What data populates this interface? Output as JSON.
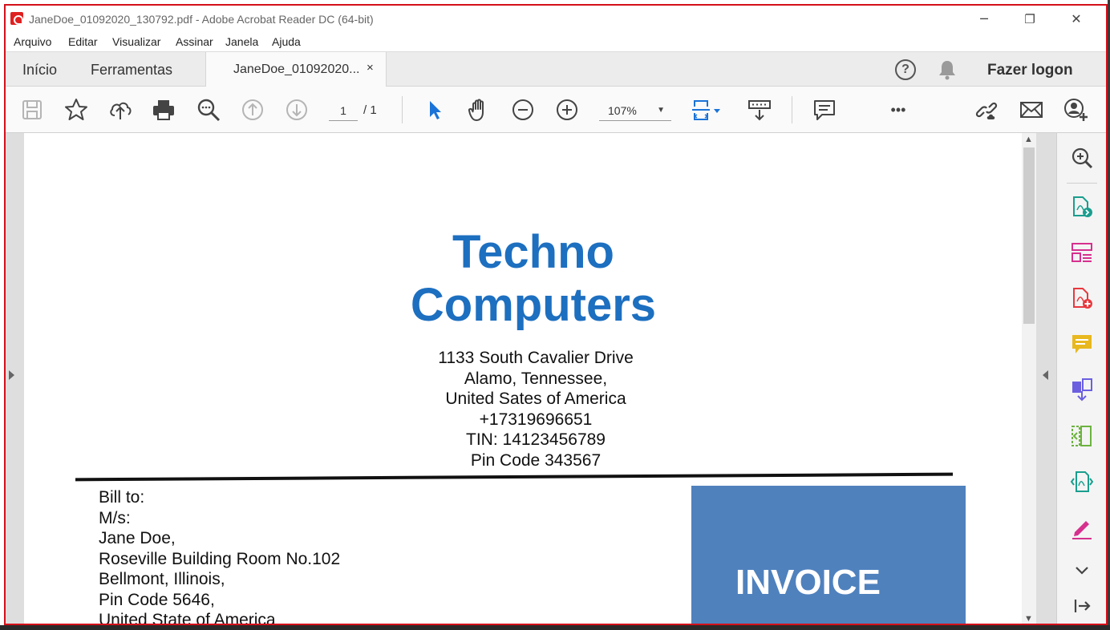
{
  "window": {
    "title": "JaneDoe_01092020_130792.pdf - Adobe Acrobat Reader DC (64-bit)",
    "minimize": "─",
    "restore": "❐",
    "close": "✕"
  },
  "menu": [
    "Arquivo",
    "Editar",
    "Visualizar",
    "Assinar",
    "Janela",
    "Ajuda"
  ],
  "tabs": {
    "home": "Início",
    "tools": "Ferramentas",
    "document": "JaneDoe_01092020...",
    "close": "×",
    "help": "?",
    "login": "Fazer logon"
  },
  "toolbar": {
    "page_current": "1",
    "page_total": "/ 1",
    "zoom": "107%",
    "zoom_caret": "▼",
    "more": "•••"
  },
  "document": {
    "company_line1": "Techno",
    "company_line2": "Computers",
    "address": [
      "1133 South Cavalier Drive",
      "Alamo, Tennessee,",
      "United Sates of America",
      "+17319696651",
      "TIN: 14123456789",
      "Pin Code 343567"
    ],
    "bill_to": [
      "Bill to:",
      "M/s:",
      "Jane Doe,",
      "Roseville Building Room No.102",
      "Bellmont, Illinois,",
      "Pin Code 5646,",
      "United State of America"
    ],
    "invoice_label": "INVOICE"
  },
  "scroll": {
    "up": "▲",
    "down": "▼"
  },
  "colors": {
    "accent_blue": "#1d6fc0",
    "invoice_box": "#4f81bd",
    "frame_red": "#d4101a"
  }
}
